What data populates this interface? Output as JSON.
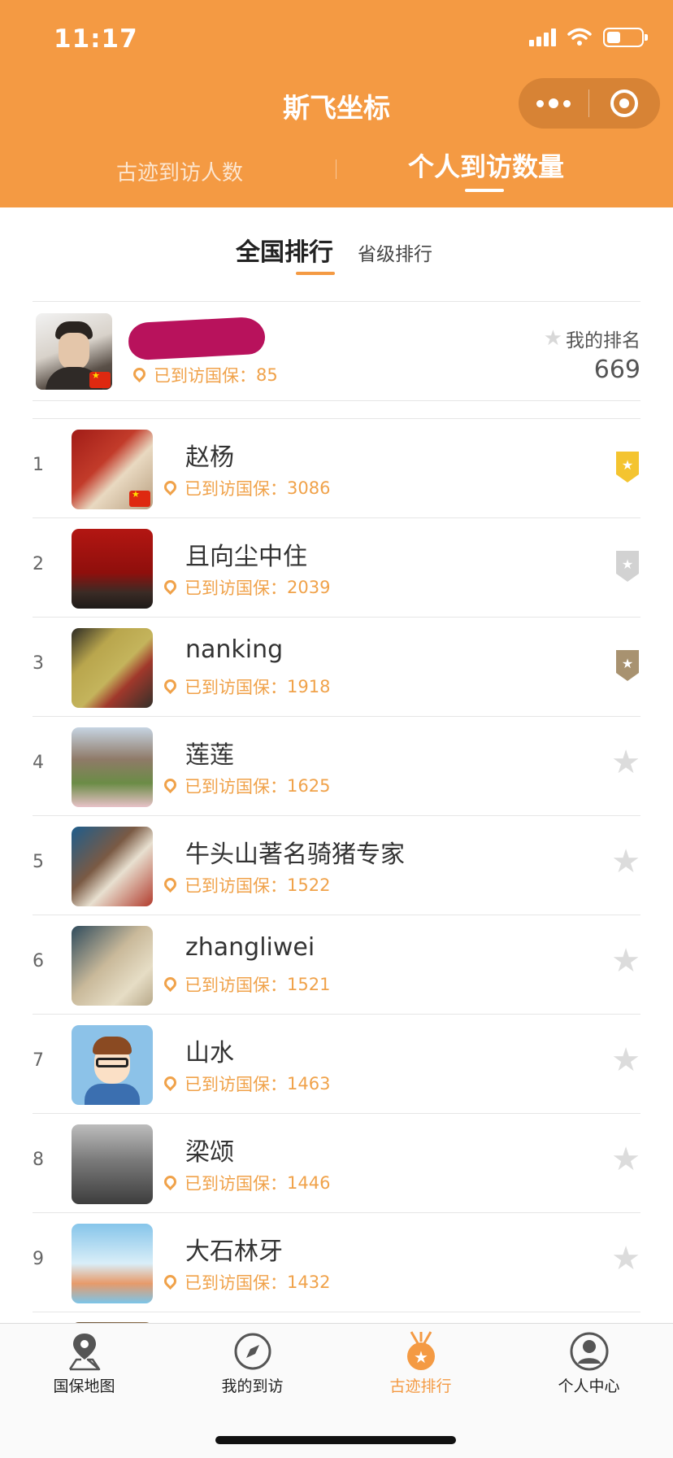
{
  "status_bar": {
    "time": "11:17",
    "battery_level": 0.4
  },
  "header": {
    "title": "斯飞坐标",
    "capsule": {
      "more_icon": "more-dots-icon",
      "close_icon": "target-close-icon"
    },
    "tabs": [
      {
        "label": "古迹到访人数",
        "active": false
      },
      {
        "label": "个人到访数量",
        "active": true
      }
    ]
  },
  "sub_tabs": [
    {
      "label": "全国排行",
      "active": true
    },
    {
      "label": "省级排行",
      "active": false
    }
  ],
  "my_card": {
    "name": "",
    "visited_label": "已到访国保：",
    "visited_count": "85",
    "rank_label": "我的排名",
    "rank_value": "669"
  },
  "rank_list": [
    {
      "rank": "1",
      "name": "赵杨",
      "visited_label": "已到访国保：",
      "visited_count": "3086",
      "badge": "gold"
    },
    {
      "rank": "2",
      "name": "且向尘中住",
      "visited_label": "已到访国保：",
      "visited_count": "2039",
      "badge": "silver"
    },
    {
      "rank": "3",
      "name": "nanking",
      "visited_label": "已到访国保：",
      "visited_count": "1918",
      "badge": "bronze"
    },
    {
      "rank": "4",
      "name": "莲莲",
      "visited_label": "已到访国保：",
      "visited_count": "1625",
      "badge": "none"
    },
    {
      "rank": "5",
      "name": "牛头山著名骑猪专家",
      "visited_label": "已到访国保：",
      "visited_count": "1522",
      "badge": "none"
    },
    {
      "rank": "6",
      "name": "zhangliwei",
      "visited_label": "已到访国保：",
      "visited_count": "1521",
      "badge": "none"
    },
    {
      "rank": "7",
      "name": "山水",
      "visited_label": "已到访国保：",
      "visited_count": "1463",
      "badge": "none"
    },
    {
      "rank": "8",
      "name": "梁颂",
      "visited_label": "已到访国保：",
      "visited_count": "1446",
      "badge": "none"
    },
    {
      "rank": "9",
      "name": "大石林牙",
      "visited_label": "已到访国保：",
      "visited_count": "1432",
      "badge": "none"
    }
  ],
  "bottom_nav": [
    {
      "label": "国保地图",
      "icon": "map-pin-icon",
      "active": false
    },
    {
      "label": "我的到访",
      "icon": "compass-icon",
      "active": false
    },
    {
      "label": "古迹排行",
      "icon": "medal-icon",
      "active": true
    },
    {
      "label": "个人中心",
      "icon": "person-icon",
      "active": false
    }
  ],
  "colors": {
    "brand_orange": "#f49a43",
    "visited_text": "#f0a24a",
    "gold": "#f4c430",
    "silver": "#c9c9c9",
    "bronze": "#a89270"
  }
}
